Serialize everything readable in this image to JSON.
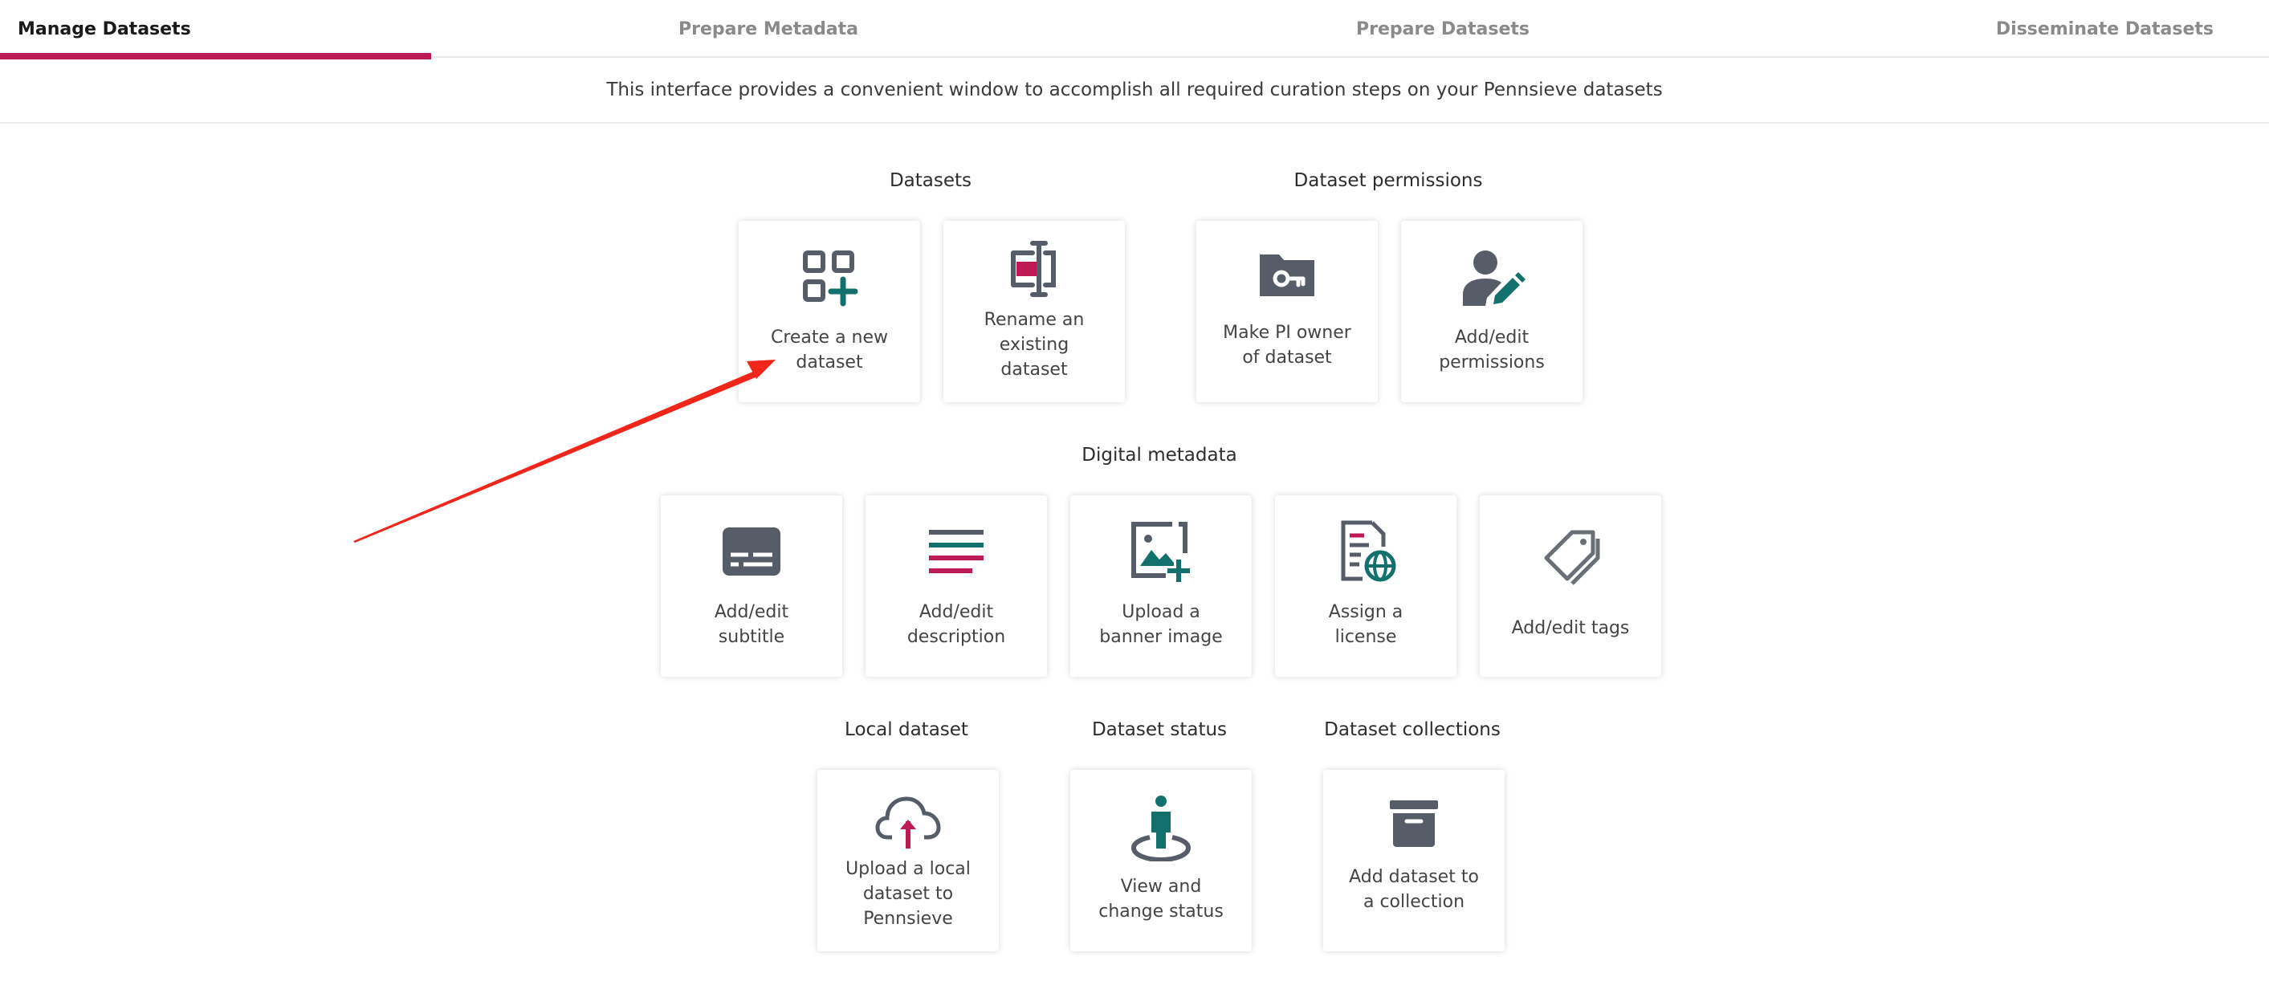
{
  "tabs": [
    {
      "label": "Manage Datasets",
      "active": true
    },
    {
      "label": "Prepare Metadata",
      "active": false
    },
    {
      "label": "Prepare Datasets",
      "active": false
    },
    {
      "label": "Disseminate Datasets",
      "active": false
    }
  ],
  "intro": "This interface provides a convenient window to accomplish all required curation steps on your Pennsieve datasets",
  "sections": {
    "datasets": "Datasets",
    "permissions": "Dataset permissions",
    "digital_metadata": "Digital metadata",
    "local_dataset": "Local dataset",
    "dataset_status": "Dataset status",
    "dataset_collections": "Dataset collections"
  },
  "cards": {
    "create": {
      "l1": "Create a new",
      "l2": "dataset",
      "icon": "grid-plus-icon"
    },
    "rename": {
      "l1": "Rename an",
      "l2": "existing",
      "l3": "dataset",
      "icon": "text-cursor-rename-icon"
    },
    "pi_owner": {
      "l1": "Make PI owner",
      "l2": "of dataset",
      "icon": "folder-key-icon"
    },
    "permissions": {
      "l1": "Add/edit",
      "l2": "permissions",
      "icon": "user-edit-icon"
    },
    "subtitle": {
      "l1": "Add/edit",
      "l2": "subtitle",
      "icon": "subtitles-icon"
    },
    "description": {
      "l1": "Add/edit",
      "l2": "description",
      "icon": "text-lines-icon"
    },
    "banner": {
      "l1": "Upload a",
      "l2": "banner image",
      "icon": "image-plus-icon"
    },
    "license": {
      "l1": "Assign a",
      "l2": "license",
      "icon": "document-globe-icon"
    },
    "tags": {
      "l1": "Add/edit tags",
      "icon": "tags-icon"
    },
    "upload_local": {
      "l1": "Upload a local",
      "l2": "dataset to",
      "l3": "Pennsieve",
      "icon": "cloud-upload-icon"
    },
    "status": {
      "l1": "View and",
      "l2": "change status",
      "icon": "person-status-icon"
    },
    "collection": {
      "l1": "Add dataset to",
      "l2": "a collection",
      "icon": "archive-box-icon"
    }
  },
  "colors": {
    "accent": "#bc1a55",
    "teal": "#13716d",
    "icon_gray": "#565c68",
    "annotation_arrow": "#f0261a"
  }
}
